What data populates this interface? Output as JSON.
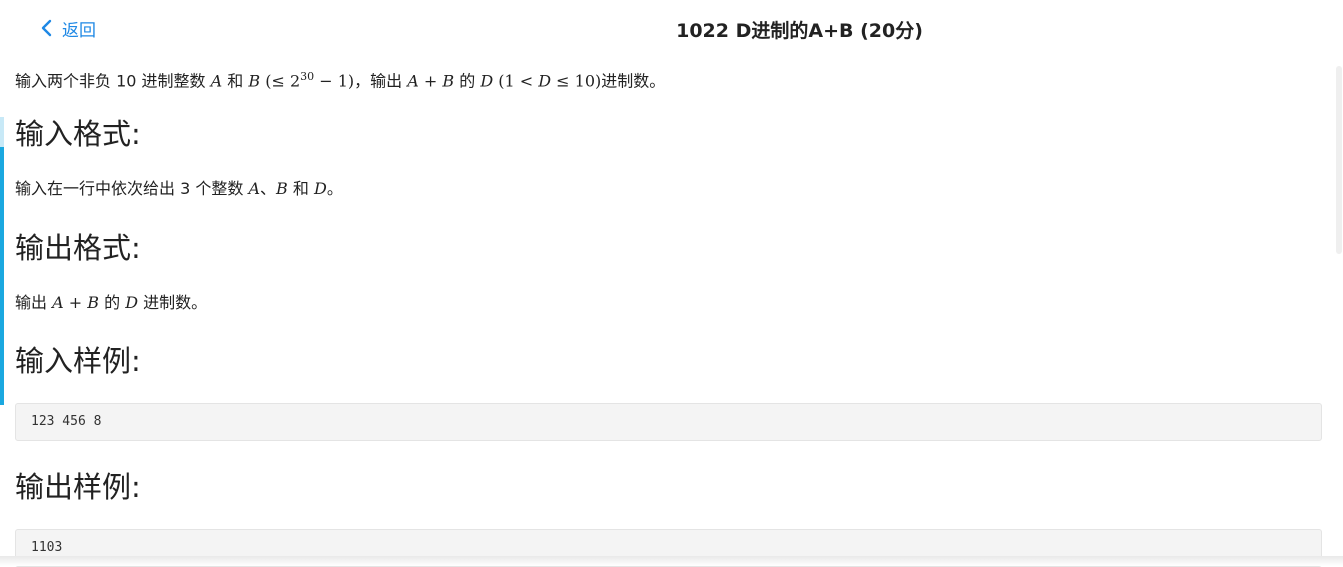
{
  "header": {
    "back_label": "返回",
    "title": "1022 D进制的A+B (20分)"
  },
  "problem": {
    "description": {
      "t1": "输入两个非负 10 进制整数 ",
      "A": "A",
      "t2": " 和 ",
      "B": "B",
      "t3": " (≤ 2",
      "exp": "30",
      "t4": " − 1)",
      "t5": "，输出 ",
      "A2": "A",
      "plus": " + ",
      "B2": "B",
      "t6": " 的 ",
      "D": "D",
      "t7": " (1 < ",
      "D2": "D",
      "t8": " ≤ 10)",
      "t9": "进制数。"
    },
    "input_heading": "输入格式:",
    "input_text": {
      "t1": "输入在一行中依次给出 3 个整数 ",
      "A": "A",
      "t2": "、",
      "B": "B",
      "t3": " 和 ",
      "D": "D",
      "t4": "。"
    },
    "output_heading": "输出格式:",
    "output_text": {
      "t1": "输出 ",
      "A": "A",
      "plus": " + ",
      "B": "B",
      "t2": " 的 ",
      "D": "D",
      "t3": " 进制数。"
    },
    "sample_input_heading": "输入样例:",
    "sample_input": "123 456 8",
    "sample_output_heading": "输出样例:",
    "sample_output": "1103"
  },
  "colors": {
    "accent": "#1e88e5",
    "sidebar_bar": "#1aa8e0",
    "code_bg": "#f4f4f4"
  }
}
